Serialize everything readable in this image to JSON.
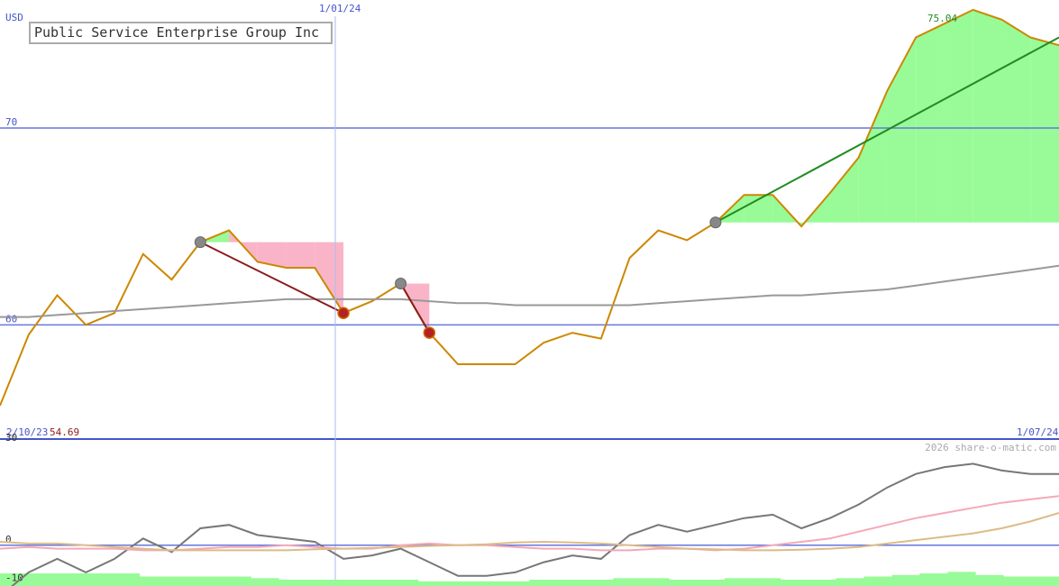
{
  "chart_data": [
    {
      "type": "line",
      "title": "Public Service Enterprise Group Inc",
      "currency": "USD",
      "x_start_label": "2/10/23",
      "x_end_label": "1/07/24",
      "marker_label": "1/01/24",
      "low_value": "54.69",
      "high_value": "75.04",
      "yticks": [
        "70",
        "60"
      ],
      "ylim": [
        54.2,
        76.5
      ],
      "x_count": 40,
      "series": [
        {
          "name": "",
          "values": [
            55.9,
            59.5,
            61.5,
            60.0,
            60.6,
            63.6,
            62.3,
            64.2,
            64.8,
            63.2,
            62.9,
            62.9,
            60.6,
            61.2,
            62.1,
            59.6,
            58.0,
            58.0,
            58.0,
            59.1,
            59.6,
            59.3,
            63.4,
            64.8,
            64.3,
            65.2,
            66.6,
            66.6,
            65.0,
            66.7,
            68.5,
            71.9,
            74.6,
            75.3,
            76.0,
            75.5,
            74.6,
            74.2
          ]
        },
        {
          "name": "",
          "values": [
            60.4,
            60.4,
            60.5,
            60.6,
            60.7,
            60.8,
            60.9,
            61.0,
            61.1,
            61.2,
            61.3,
            61.3,
            61.3,
            61.3,
            61.3,
            61.2,
            61.1,
            61.1,
            61.0,
            61.0,
            61.0,
            61.0,
            61.0,
            61.1,
            61.2,
            61.3,
            61.4,
            61.5,
            61.5,
            61.6,
            61.7,
            61.8,
            62.0,
            62.2,
            62.4,
            62.6,
            62.8,
            63.0
          ]
        }
      ],
      "trades": [
        {
          "from": 7,
          "to": 12,
          "from_value": 64.2,
          "to_value": 60.6
        },
        {
          "from": 14,
          "to": 15,
          "from_value": 62.1,
          "to_value": 59.6
        },
        {
          "from": 25,
          "to": 39,
          "from_value": 65.2,
          "to_value": 74.6
        }
      ],
      "accent_colors": {
        "price": "#cc8800",
        "ma": "#999999",
        "gain": "#98fb98",
        "loss": "#f9b4c8",
        "loss_trade": "#8b1a1a",
        "gain_trade": "#228b22",
        "grid": "#6677dd",
        "tick_text": "#4455cc",
        "low_text": "#8b1a1a",
        "high_text": "#228b22"
      }
    },
    {
      "type": "line",
      "title": "",
      "yticks": [
        "30",
        "0",
        "-10"
      ],
      "ylim": [
        -12,
        31
      ],
      "series": [
        {
          "name": "",
          "values": [
            -15,
            -8,
            -4,
            -8,
            -4,
            2,
            -2,
            5,
            6,
            3,
            2,
            1,
            -4,
            -3,
            -1,
            -5,
            -9,
            -9,
            -8,
            -5,
            -3,
            -4,
            3,
            6,
            4,
            6,
            8,
            9,
            5,
            8,
            12,
            17,
            21,
            23,
            24,
            22,
            21,
            21
          ]
        },
        {
          "name": "",
          "values": [
            -1,
            -0.5,
            -1,
            -1,
            -1,
            -1.5,
            -1.5,
            -1,
            -0.5,
            -0.5,
            0,
            -0.5,
            -1,
            -1,
            0,
            0.5,
            0,
            0,
            -0.5,
            -1,
            -1,
            -1.5,
            -1.5,
            -1,
            -1,
            -1.5,
            -1,
            0,
            1,
            2,
            4,
            6,
            8,
            9.5,
            11,
            12.5,
            13.5,
            14.5
          ]
        },
        {
          "name": "",
          "values": [
            1,
            0.5,
            0.5,
            0,
            -0.5,
            -1,
            -1.5,
            -1.5,
            -1.5,
            -1.5,
            -1.5,
            -1.2,
            -1,
            -0.8,
            -0.5,
            -0.2,
            0,
            0.3,
            0.8,
            1,
            0.8,
            0.5,
            0,
            -0.5,
            -1,
            -1.2,
            -1.5,
            -1.5,
            -1.3,
            -1,
            -0.5,
            0.5,
            1.5,
            2.5,
            3.5,
            5,
            7,
            9.5
          ]
        }
      ],
      "volume_bars": [
        0.4,
        0.4,
        0.4,
        0.4,
        0.4,
        0.3,
        0.3,
        0.3,
        0.3,
        0.25,
        0.2,
        0.2,
        0.2,
        0.2,
        0.2,
        0.15,
        0.15,
        0.15,
        0.15,
        0.2,
        0.2,
        0.2,
        0.25,
        0.25,
        0.2,
        0.2,
        0.25,
        0.25,
        0.2,
        0.2,
        0.25,
        0.3,
        0.35,
        0.4,
        0.45,
        0.35,
        0.3,
        0.3
      ],
      "watermark": "2026 share-o-matic.com",
      "accent_colors": {
        "momentum": "#777777",
        "pink": "#f4a8b8",
        "tan": "#ddbb88",
        "volume": "#98fb98"
      }
    }
  ]
}
